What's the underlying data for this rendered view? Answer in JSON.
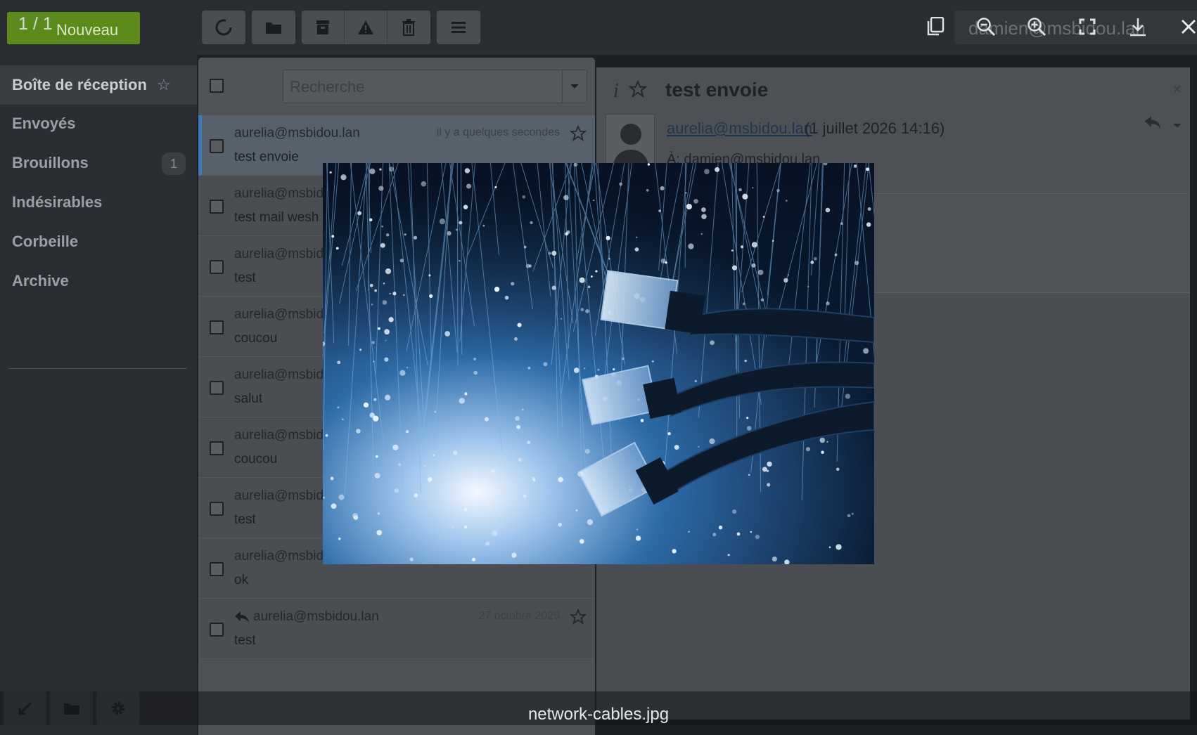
{
  "app": {
    "new_button": "Nouveau",
    "user": "damien@msbidou.lan"
  },
  "sidebar": {
    "folders": [
      {
        "label": "Boîte de réception",
        "active": true
      },
      {
        "label": "Envoyés"
      },
      {
        "label": "Brouillons",
        "badge": "1"
      },
      {
        "label": "Indésirables"
      },
      {
        "label": "Corbeille"
      },
      {
        "label": "Archive"
      }
    ]
  },
  "search": {
    "placeholder": "Recherche"
  },
  "messages": [
    {
      "from": "aurelia@msbidou.lan",
      "subject": "test envoie",
      "date": "il y a quelques secondes",
      "selected": true
    },
    {
      "from": "aurelia@msbidou.lan",
      "subject": "test mail wesh br"
    },
    {
      "from": "aurelia@msbidou.lan",
      "subject": "test"
    },
    {
      "from": "aurelia@msbidou.lan",
      "subject": "coucou"
    },
    {
      "from": "aurelia@msbidou.lan",
      "subject": "salut"
    },
    {
      "from": "aurelia@msbidou.lan",
      "subject": "coucou"
    },
    {
      "from": "aurelia@msbidou.lan",
      "subject": "test"
    },
    {
      "from": "aurelia@msbidou.lan",
      "subject": "ok"
    },
    {
      "from": "aurelia@msbidou.lan",
      "subject": "test",
      "date": "27 octobre 2025",
      "replied": true
    }
  ],
  "reading": {
    "title": "test envoie",
    "from": "aurelia@msbidou.lan",
    "date": "(1 juillet 2026 14:16)",
    "to": "À: damien@msbidou.lan"
  },
  "viewer": {
    "counter": "1 / 1",
    "filename": "network-cables.jpg",
    "tools": [
      "copy-icon",
      "zoom-out-icon",
      "zoom-in-icon",
      "fullscreen-icon",
      "download-icon",
      "close-icon"
    ]
  },
  "colors": {
    "accent": "#3f79b8",
    "new_button": "#5c8a1c",
    "photo_blue": "#1f5a9a"
  }
}
